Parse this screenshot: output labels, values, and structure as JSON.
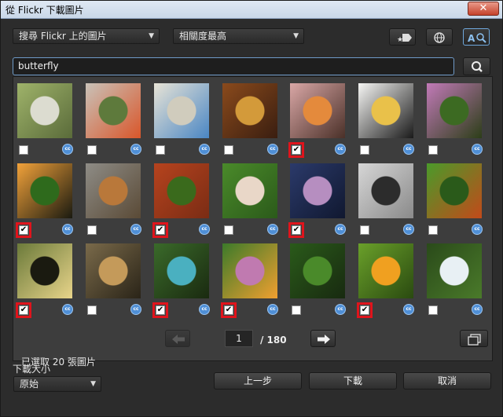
{
  "window": {
    "title": "從 Flickr 下載圖片",
    "close_glyph": "✕"
  },
  "toolbar": {
    "source": "搜尋 Flickr 上的圖片",
    "sort": "相關度最高",
    "dropdown_arrow": "▼",
    "icons": [
      "favorite-tag-icon",
      "globe-icon",
      "text-search-icon"
    ]
  },
  "search": {
    "value": "butterfly"
  },
  "grid": {
    "check_glyph": "✔",
    "cc_label": "cc",
    "items": [
      {
        "checked": false,
        "highlight": false,
        "colors": [
          "#9fb36a",
          "#dcdcd0",
          "#5a6b3a"
        ]
      },
      {
        "checked": false,
        "highlight": false,
        "colors": [
          "#c9c2b8",
          "#5e7a3c",
          "#d9562a"
        ]
      },
      {
        "checked": false,
        "highlight": false,
        "colors": [
          "#e8e4d6",
          "#d0ccbd",
          "#4a86c4"
        ]
      },
      {
        "checked": false,
        "highlight": false,
        "colors": [
          "#8a4a1c",
          "#d39a3a",
          "#3a1e10"
        ]
      },
      {
        "checked": true,
        "highlight": true,
        "colors": [
          "#d9a7a6",
          "#e48a3c",
          "#4a3028"
        ]
      },
      {
        "checked": false,
        "highlight": false,
        "colors": [
          "#f6f6f4",
          "#e9c14a",
          "#1a1a1a"
        ]
      },
      {
        "checked": false,
        "highlight": false,
        "colors": [
          "#c27ab8",
          "#3c6a22",
          "#2c3e18"
        ]
      },
      {
        "checked": true,
        "highlight": true,
        "colors": [
          "#f2a23a",
          "#2e6a1c",
          "#1a1a10"
        ]
      },
      {
        "checked": false,
        "highlight": false,
        "colors": [
          "#8e8c86",
          "#b9783a",
          "#5a4a36"
        ]
      },
      {
        "checked": true,
        "highlight": true,
        "colors": [
          "#b6431e",
          "#3a6a1c",
          "#7a2c14"
        ]
      },
      {
        "checked": false,
        "highlight": false,
        "colors": [
          "#4a8a2a",
          "#e9d7c8",
          "#2b5a1a"
        ]
      },
      {
        "checked": true,
        "highlight": true,
        "colors": [
          "#2b3a6a",
          "#b68ec0",
          "#101830"
        ]
      },
      {
        "checked": false,
        "highlight": false,
        "colors": [
          "#d6d6d6",
          "#2c2c2c",
          "#8a8a8a"
        ]
      },
      {
        "checked": false,
        "highlight": false,
        "colors": [
          "#4a9a2a",
          "#2a5a1a",
          "#c24a1a"
        ]
      },
      {
        "checked": true,
        "highlight": true,
        "colors": [
          "#6b7a3a",
          "#1a1a10",
          "#e8d48a"
        ]
      },
      {
        "checked": false,
        "highlight": false,
        "colors": [
          "#7a6a4a",
          "#c49a5a",
          "#2a2418"
        ]
      },
      {
        "checked": true,
        "highlight": true,
        "colors": [
          "#3a6a2a",
          "#4ab0c0",
          "#1a2a10"
        ]
      },
      {
        "checked": true,
        "highlight": true,
        "colors": [
          "#3c7a2a",
          "#c07ab0",
          "#f0a030"
        ]
      },
      {
        "checked": false,
        "highlight": false,
        "colors": [
          "#2a5a1a",
          "#4a8a2a",
          "#182a10"
        ]
      },
      {
        "checked": true,
        "highlight": true,
        "colors": [
          "#6aa02a",
          "#f0a020",
          "#2a4a10"
        ]
      },
      {
        "checked": false,
        "highlight": false,
        "colors": [
          "#2a4a1a",
          "#e8f0f4",
          "#4a7a2a"
        ]
      }
    ]
  },
  "footer": {
    "selected": "已選取 20 張圖片",
    "page": "1",
    "total": "/ 180",
    "prev_glyph": "⬅",
    "next_glyph": "➡"
  },
  "download": {
    "label": "下載大小",
    "size": "原始",
    "buttons": {
      "back": "上一步",
      "download": "下載",
      "cancel": "取消"
    }
  }
}
